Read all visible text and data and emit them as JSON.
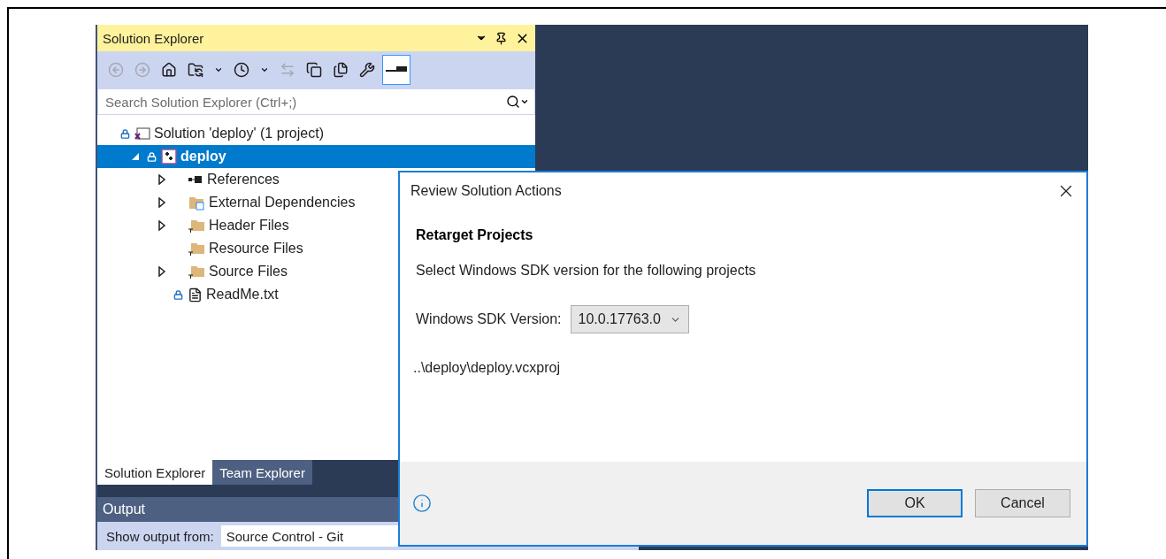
{
  "solution_explorer": {
    "title": "Solution Explorer",
    "toolbar": [
      {
        "kind": "back",
        "disabled": true
      },
      {
        "kind": "forward",
        "disabled": true
      },
      {
        "kind": "home",
        "disabled": false
      },
      {
        "kind": "switch-views",
        "disabled": false
      },
      {
        "kind": "dropdown",
        "disabled": false
      },
      {
        "kind": "pending-changes",
        "disabled": false
      },
      {
        "kind": "dropdown",
        "disabled": false
      },
      {
        "kind": "sync",
        "disabled": true
      },
      {
        "kind": "collapse",
        "disabled": false
      },
      {
        "kind": "show-all",
        "disabled": false
      },
      {
        "kind": "properties",
        "disabled": false
      },
      {
        "kind": "preview",
        "disabled": false,
        "pressed": true
      }
    ],
    "search": {
      "placeholder": "Search Solution Explorer (Ctrl+;)"
    },
    "tree": [
      {
        "label": "Solution 'deploy' (1 project)",
        "kind": "solution",
        "locked": true,
        "selected": false,
        "children": [
          {
            "label": "deploy",
            "kind": "project",
            "locked": true,
            "selected": true,
            "expanded": true,
            "children": [
              {
                "label": "References",
                "kind": "references",
                "locked": false,
                "selected": false,
                "expanded": false
              },
              {
                "label": "External Dependencies",
                "kind": "external",
                "locked": false,
                "selected": false,
                "expanded": false
              },
              {
                "label": "Header Files",
                "kind": "filter",
                "locked": false,
                "selected": false,
                "expanded": false
              },
              {
                "label": "Resource Files",
                "kind": "filter",
                "locked": false,
                "selected": false
              },
              {
                "label": "Source Files",
                "kind": "filter",
                "locked": false,
                "selected": false,
                "expanded": false
              },
              {
                "label": "ReadMe.txt",
                "kind": "file",
                "locked": true,
                "selected": false
              }
            ]
          }
        ]
      }
    ],
    "tabs": [
      {
        "label": "Solution Explorer",
        "selected": true
      },
      {
        "label": "Team Explorer",
        "selected": false
      }
    ]
  },
  "output": {
    "title": "Output",
    "show_from_label": "Show output from:",
    "source": "Source Control - Git"
  },
  "dialog": {
    "title": "Review Solution Actions",
    "heading": "Retarget Projects",
    "description": "Select Windows SDK version for the following projects",
    "sdk_label": "Windows SDK Version:",
    "sdk_value": "10.0.17763.0",
    "project_path": "..\\deploy\\deploy.vcxproj",
    "buttons": [
      {
        "label": "OK",
        "default": true
      },
      {
        "label": "Cancel",
        "default": false
      }
    ]
  }
}
